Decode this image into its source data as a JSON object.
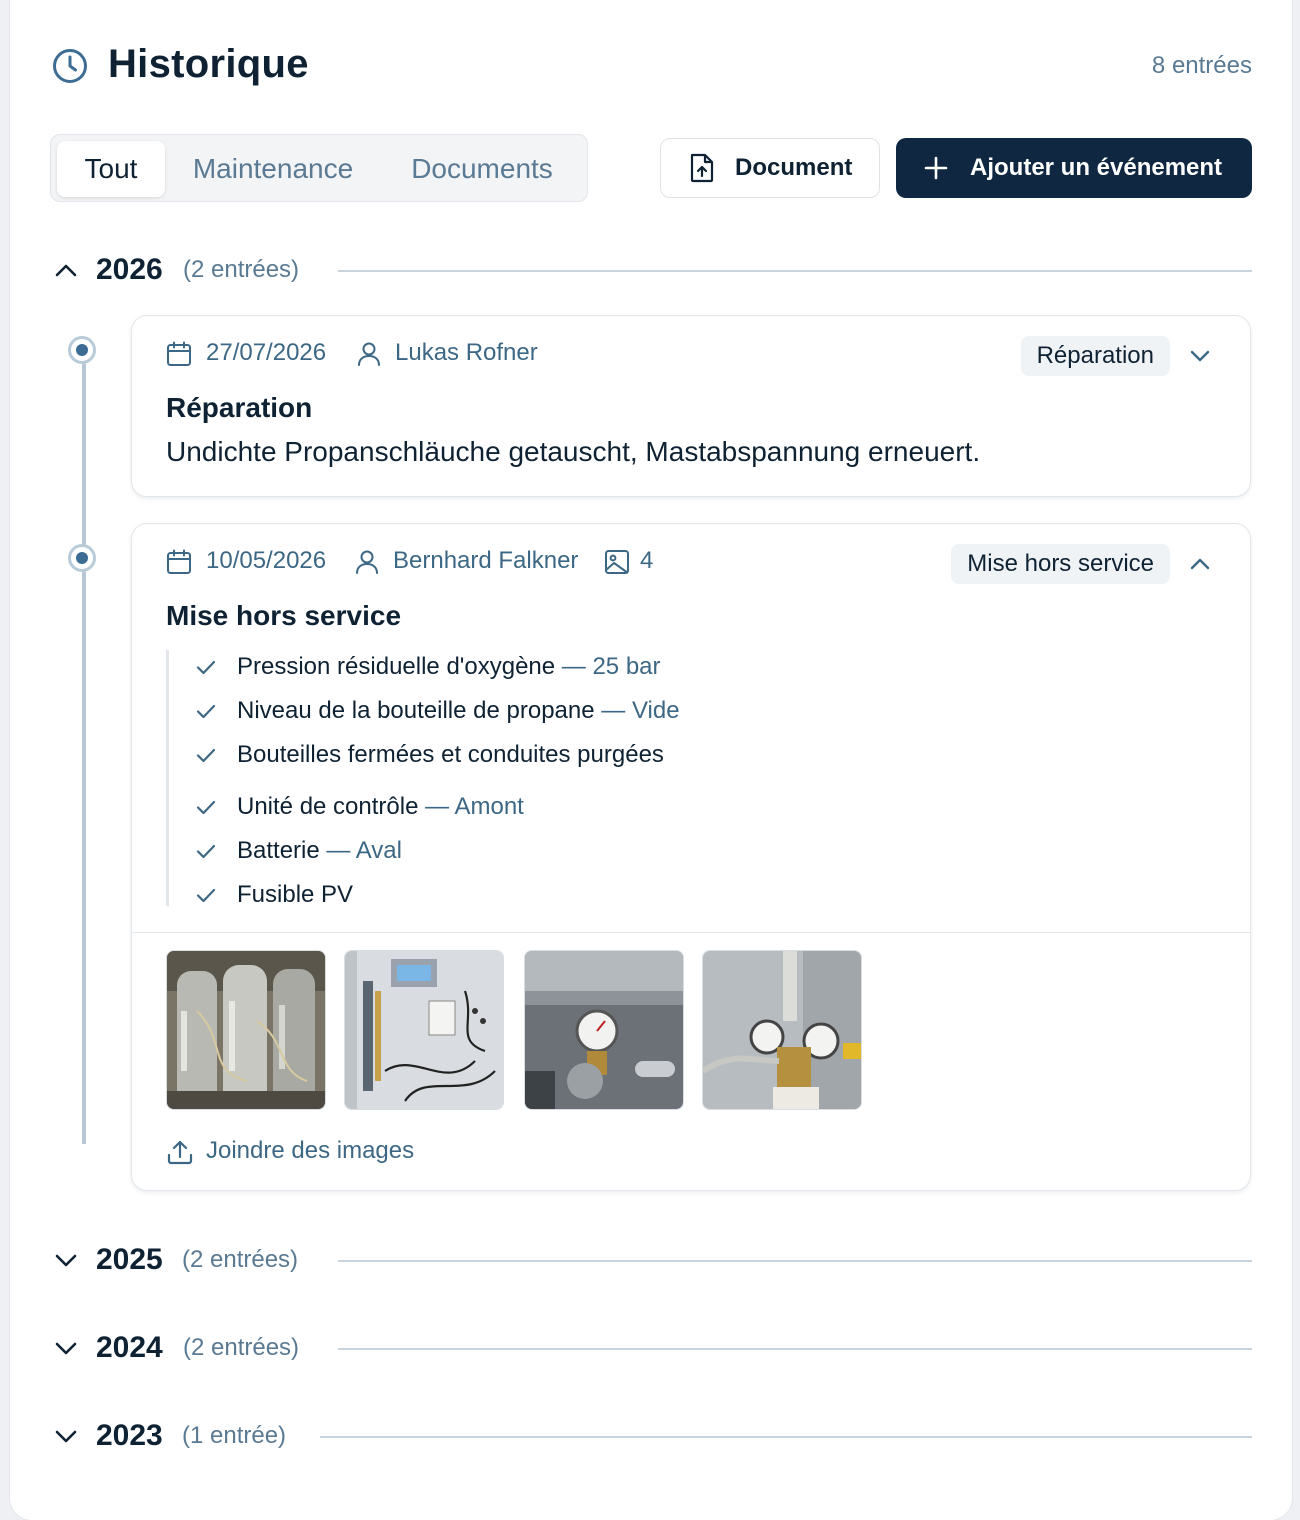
{
  "header": {
    "title": "Historique",
    "entry_count": "8 entrées",
    "icon": "clock-icon"
  },
  "tabs": [
    {
      "label": "Tout",
      "active": true
    },
    {
      "label": "Maintenance",
      "active": false
    },
    {
      "label": "Documents",
      "active": false
    }
  ],
  "actions": {
    "document_label": "Document",
    "add_event_label": "Ajouter un événement"
  },
  "years": [
    {
      "year": "2026",
      "count": "(2 entrées)",
      "expanded": true
    },
    {
      "year": "2025",
      "count": "(2 entrées)",
      "expanded": false
    },
    {
      "year": "2024",
      "count": "(2 entrées)",
      "expanded": false
    },
    {
      "year": "2023",
      "count": "(1 entrée)",
      "expanded": false
    }
  ],
  "events": [
    {
      "date": "27/07/2026",
      "author": "Lukas Rofner",
      "badge": "Réparation",
      "title": "Réparation",
      "description": "Undichte Propanschläuche getauscht, Mastabspannung erneuert.",
      "expanded": false
    },
    {
      "date": "10/05/2026",
      "author": "Bernhard Falkner",
      "image_count": "4",
      "badge": "Mise hors service",
      "title": "Mise hors service",
      "expanded": true,
      "checklist": [
        {
          "label": "Pression résiduelle d'oxygène",
          "value": "— 25 bar"
        },
        {
          "label": "Niveau de la bouteille de propane",
          "value": "— Vide"
        },
        {
          "label": "Bouteilles fermées et conduites purgées",
          "value": ""
        },
        {
          "label": "Unité de contrôle",
          "value": "— Amont"
        },
        {
          "label": "Batterie",
          "value": "— Aval"
        },
        {
          "label": "Fusible PV",
          "value": ""
        }
      ],
      "attach_label": "Joindre des images"
    }
  ],
  "colors": {
    "primary_dark": "#0f2740",
    "muted": "#5a7a93",
    "accent": "#3d6885"
  }
}
